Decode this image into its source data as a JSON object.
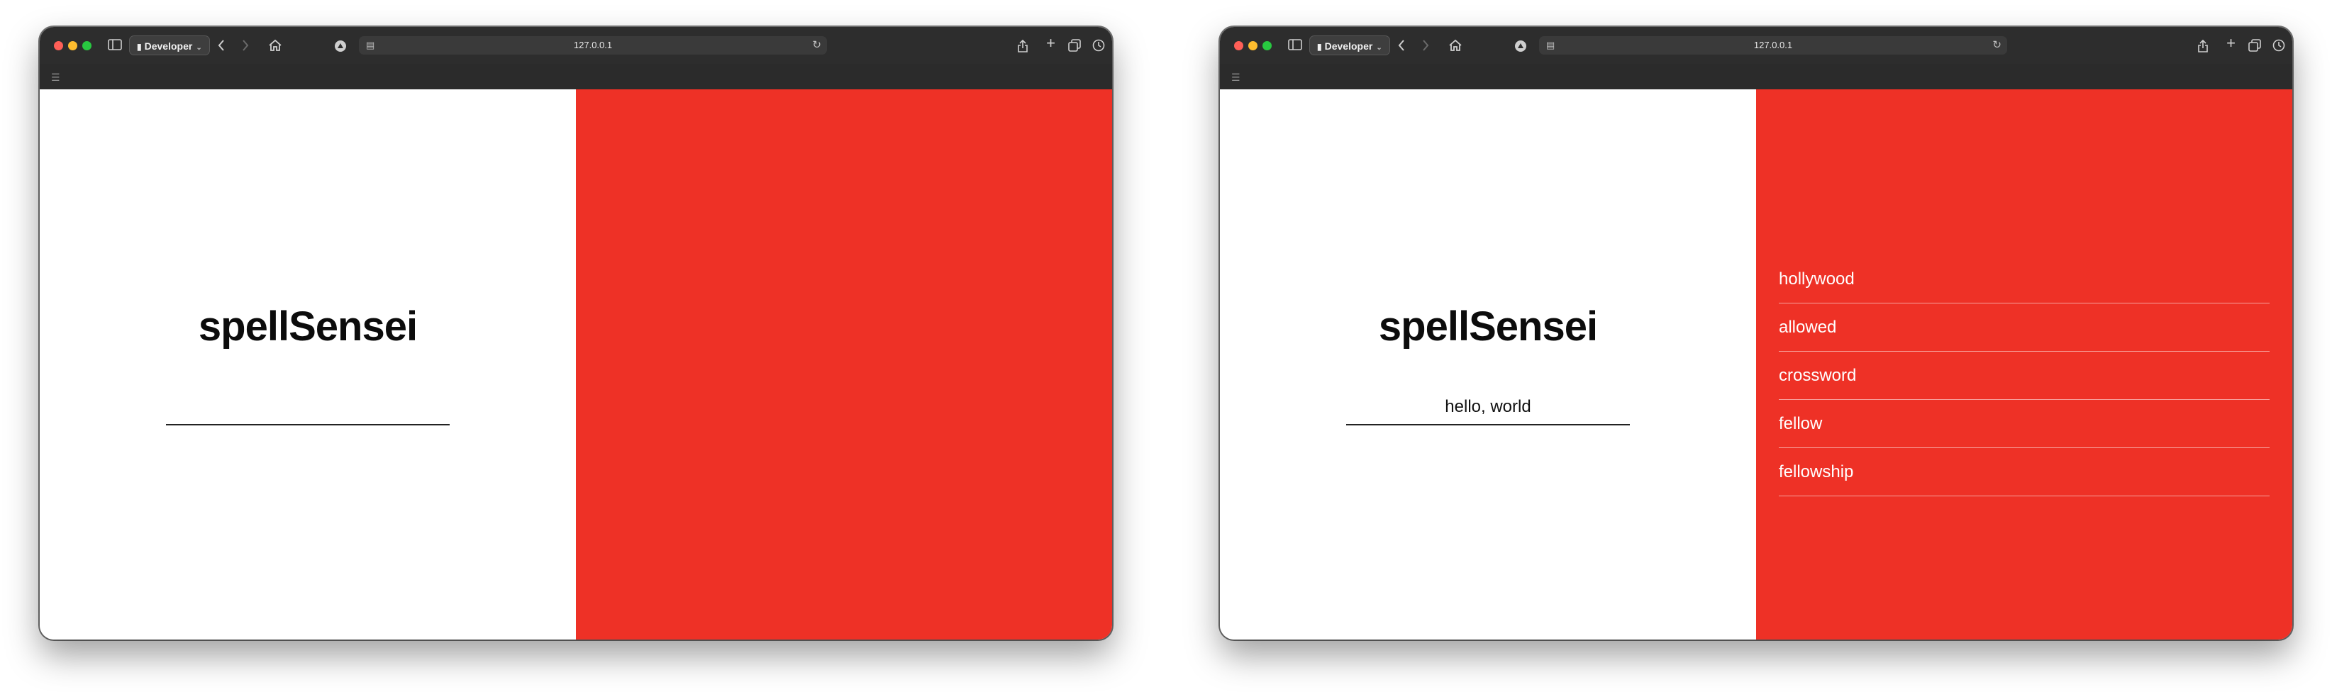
{
  "browser": {
    "profile_label": "Developer",
    "url": "127.0.0.1"
  },
  "windows": [
    {
      "app": {
        "title": "spellSensei",
        "input_value": ""
      },
      "suggestions": []
    },
    {
      "app": {
        "title": "spellSensei",
        "input_value": "hello, world"
      },
      "suggestions": [
        "hollywood",
        "allowed",
        "crossword",
        "fellow",
        "fellowship"
      ]
    }
  ],
  "colors": {
    "accent_red": "#ee3126",
    "titlebar": "#2d2d2d",
    "page_bg": "#ffffff"
  },
  "icons": [
    "sidebar-icon",
    "lock-icon",
    "back-icon",
    "forward-icon",
    "home-icon",
    "extension-icon",
    "site-icon",
    "reload-icon",
    "share-icon",
    "new-tab-icon",
    "tabs-overview-icon",
    "clock-icon",
    "bookmarks-icon"
  ]
}
